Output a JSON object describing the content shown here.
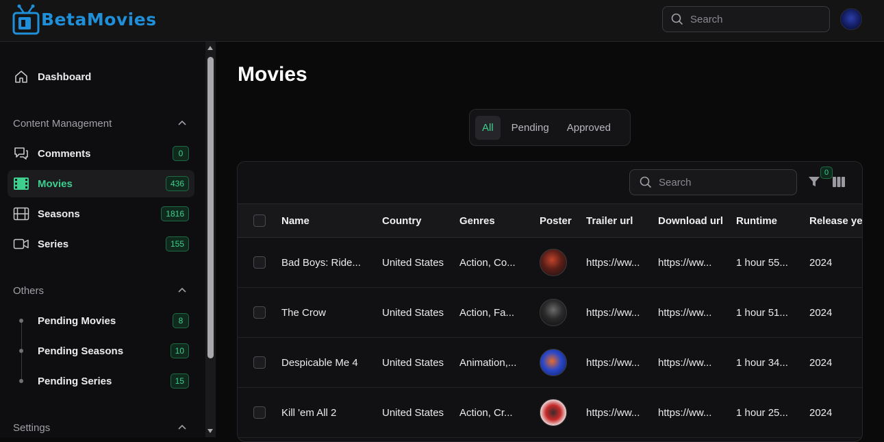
{
  "app": {
    "logo_text": "BetaMovies",
    "search_placeholder": "Search"
  },
  "sidebar": {
    "dashboard": "Dashboard",
    "content_management": {
      "title": "Content Management",
      "items": [
        {
          "label": "Comments",
          "count": "0"
        },
        {
          "label": "Movies",
          "count": "436"
        },
        {
          "label": "Seasons",
          "count": "1816"
        },
        {
          "label": "Series",
          "count": "155"
        }
      ]
    },
    "others": {
      "title": "Others",
      "items": [
        {
          "label": "Pending Movies",
          "count": "8"
        },
        {
          "label": "Pending Seasons",
          "count": "10"
        },
        {
          "label": "Pending Series",
          "count": "15"
        }
      ]
    },
    "settings": {
      "title": "Settings"
    }
  },
  "main": {
    "title": "Movies",
    "tabs": [
      "All",
      "Pending",
      "Approved"
    ],
    "active_tab": "All",
    "table": {
      "search_placeholder": "Search",
      "filter_count": "0",
      "columns": [
        "Name",
        "Country",
        "Genres",
        "Poster",
        "Trailer url",
        "Download url",
        "Runtime",
        "Release year"
      ],
      "rows": [
        {
          "name": "Bad Boys: Ride...",
          "country": "United States",
          "genres": "Action, Co...",
          "trailer": "https://ww...",
          "download": "https://ww...",
          "runtime": "1 hour 55...",
          "year": "2024"
        },
        {
          "name": "The Crow",
          "country": "United States",
          "genres": "Action, Fa...",
          "trailer": "https://ww...",
          "download": "https://ww...",
          "runtime": "1 hour 51...",
          "year": "2024"
        },
        {
          "name": "Despicable Me 4",
          "country": "United States",
          "genres": "Animation,...",
          "trailer": "https://ww...",
          "download": "https://ww...",
          "runtime": "1 hour 34...",
          "year": "2024"
        },
        {
          "name": "Kill 'em All 2",
          "country": "United States",
          "genres": "Action, Cr...",
          "trailer": "https://ww...",
          "download": "https://ww...",
          "runtime": "1 hour 25...",
          "year": "2024"
        }
      ]
    }
  },
  "colors": {
    "accent": "#3ecf8e",
    "logo": "#1e8fd8",
    "background": "#0a0a0b"
  }
}
